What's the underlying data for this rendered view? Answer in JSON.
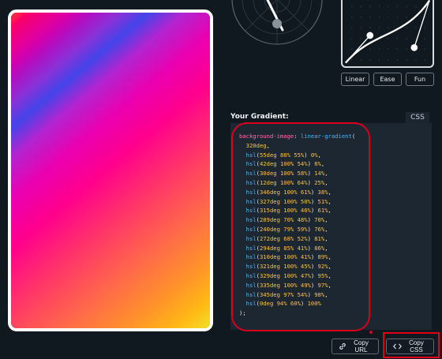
{
  "colors": {
    "background": "#101820",
    "code_bg": "#1d2731",
    "annotation_red": "#d9001c",
    "syntax_property": "#ff6dac",
    "syntax_function": "#4fb4f5",
    "syntax_number": "#ffc13d"
  },
  "easing": {
    "buttons": [
      "Linear",
      "Ease",
      "Fun"
    ]
  },
  "gradient": {
    "label": "Your Gradient:",
    "tab": "CSS",
    "code": {
      "property": "background-image",
      "function": "linear-gradient",
      "angle": "320deg",
      "stops": [
        {
          "h": "55deg",
          "s": "88%",
          "l": "55%",
          "pos": "0%"
        },
        {
          "h": "42deg",
          "s": "100%",
          "l": "54%",
          "pos": "6%"
        },
        {
          "h": "30deg",
          "s": "100%",
          "l": "58%",
          "pos": "14%"
        },
        {
          "h": "12deg",
          "s": "100%",
          "l": "64%",
          "pos": "25%"
        },
        {
          "h": "346deg",
          "s": "100%",
          "l": "61%",
          "pos": "38%"
        },
        {
          "h": "327deg",
          "s": "100%",
          "l": "50%",
          "pos": "51%"
        },
        {
          "h": "315deg",
          "s": "100%",
          "l": "46%",
          "pos": "61%"
        },
        {
          "h": "289deg",
          "s": "70%",
          "l": "48%",
          "pos": "70%"
        },
        {
          "h": "240deg",
          "s": "79%",
          "l": "59%",
          "pos": "76%"
        },
        {
          "h": "272deg",
          "s": "68%",
          "l": "52%",
          "pos": "81%"
        },
        {
          "h": "294deg",
          "s": "85%",
          "l": "41%",
          "pos": "86%"
        },
        {
          "h": "310deg",
          "s": "100%",
          "l": "41%",
          "pos": "89%"
        },
        {
          "h": "321deg",
          "s": "100%",
          "l": "45%",
          "pos": "92%"
        },
        {
          "h": "329deg",
          "s": "100%",
          "l": "47%",
          "pos": "95%"
        },
        {
          "h": "335deg",
          "s": "100%",
          "l": "49%",
          "pos": "97%"
        },
        {
          "h": "345deg",
          "s": "97%",
          "l": "54%",
          "pos": "98%"
        },
        {
          "h": "0deg",
          "s": "94%",
          "l": "60%",
          "pos": "100%"
        }
      ]
    }
  },
  "actions": {
    "copy_url": {
      "label": "Copy URL",
      "icon": "link-icon"
    },
    "copy_css": {
      "label": "Copy CSS",
      "icon": "code-icon"
    }
  }
}
